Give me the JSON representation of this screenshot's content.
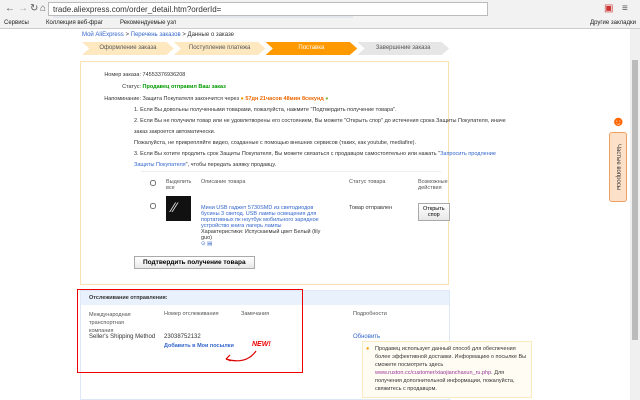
{
  "browser": {
    "url": "trade.aliexpress.com/order_detail.htm?orderId=",
    "bookmarks": [
      "Сервисы",
      "Коллекция веб-фраг",
      "Рекомендуемые узл"
    ],
    "other_bookmarks": "Другие закладки"
  },
  "breadcrumb": {
    "items": [
      "Мой AliExpress",
      "Перечень заказов",
      "Данные о заказе"
    ],
    "sep": ">"
  },
  "steps": [
    {
      "label": "Оформление заказа"
    },
    {
      "label": "Поступление платежа"
    },
    {
      "label": "Поставка"
    },
    {
      "label": "Завершение заказа"
    }
  ],
  "order": {
    "number_label": "Номер заказа:",
    "number": "74553376936208",
    "status_label": "Статус:",
    "status": "Продавец отправил Ваш заказ",
    "reminder_label": "Напоминание:",
    "reminder": "Защита Покупателя закончится через",
    "countdown": "57дн 21часов 48мин 8секунд",
    "notes": [
      "1. Если Вы довольны полученными товарами, пожалуйста, нажмите \"Подтвердить получение товара\".",
      "2. Если Вы не получили товар или не удовлетворены его состоянием, Вы можете \"Открыть спор\" до истечения срока Защиты Покупателя, иначе",
      "заказ закроется автоматически.",
      "Пожалуйста, не прикрепляйте видео, созданные с помощью внешних сервисов (таких, как youtube, mediafire).",
      "3. Если Вы хотите продлить срок Защиты Покупателя, Вы можете связаться с продавцом самостоятельно или нажать \""
    ],
    "extend_link": "Запросить продление",
    "extend_link2": "Защиты Покупателя",
    "extend_tail": "\", чтобы передать заявку продавцу."
  },
  "items_table": {
    "headers": [
      "Выделить все",
      "Описание товара",
      "Статус товара",
      "Возможные действия"
    ],
    "item": {
      "title": "Мини USB гаджет 5730SMD из светодиодов бусины 3 светод. USB лампы освещения для портативных пк ноутбук мобильного зарядное устройство книга лагерь лампы",
      "specs": "Характеристики: Испускаемый цвет Белый (lily guo)",
      "status": "Товар отправлен",
      "action": "Открыть спор"
    },
    "confirm_button": "Подтвердить получение товара"
  },
  "tracking": {
    "title": "Отслеживание отправления:",
    "headers": [
      "Международная транспортная компания",
      "Номер отслеживания",
      "Замечания",
      "Подробности"
    ],
    "carrier": "Seller's Shipping Method",
    "number": "23038752132",
    "add_link": "Добавить в Мои посылки",
    "new_badge": "NEW!",
    "refresh": "Обновить",
    "note": "Продавец использует данный способ для обеспечения более эффективной доставки. Информацию о посылке Вы сможете посмотреть здесь",
    "note_link": "www.ruston.cc/customer/xiaojianchaxun_ru.php",
    "note_tail": ". Для получения дополнительной информации, пожалуйста, свяжитесь с продавцом."
  },
  "help_widget": {
    "label": "Частые вопросы"
  },
  "colors": {
    "accent": "#ff9900",
    "link": "#3366cc",
    "status": "#009900",
    "highlight": "#ee0000"
  }
}
